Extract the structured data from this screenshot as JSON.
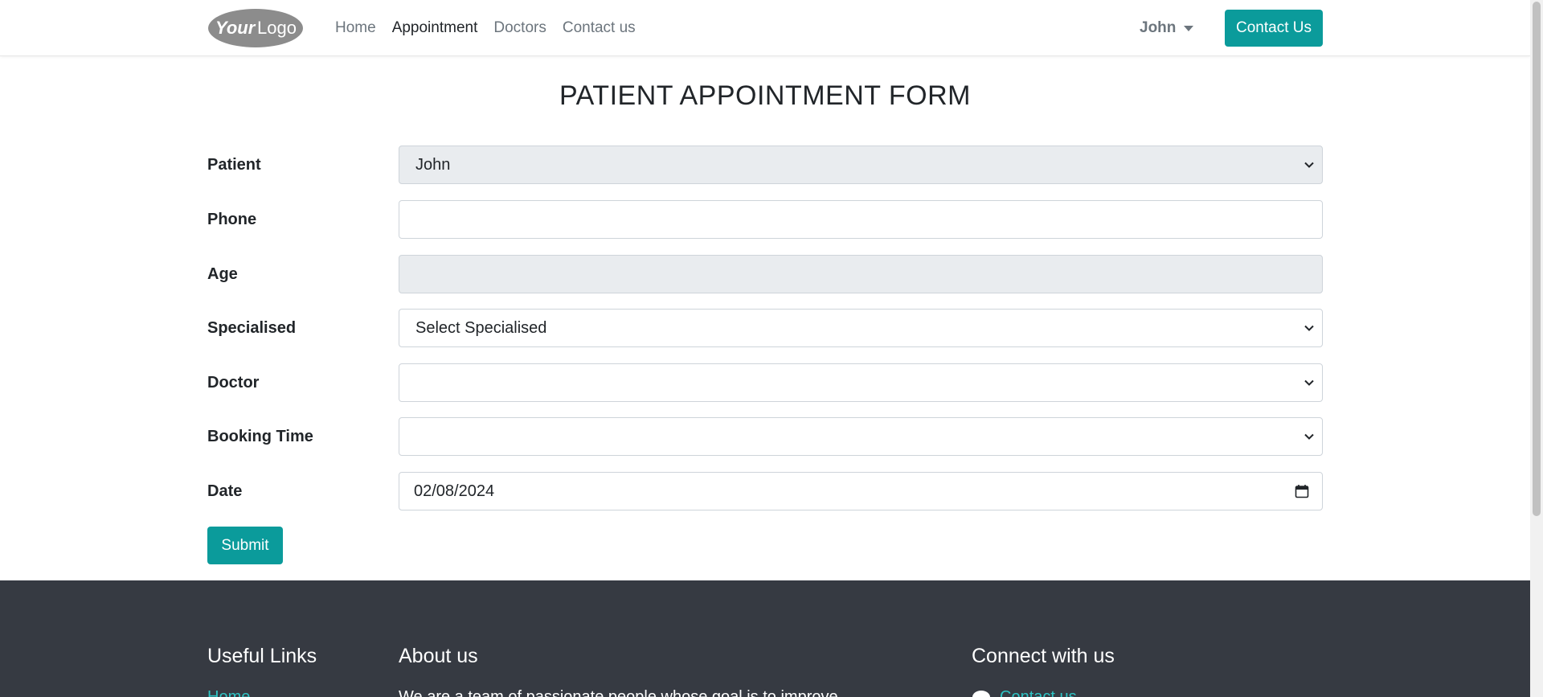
{
  "header": {
    "logo_text": "YourLogo",
    "nav": [
      {
        "label": "Home",
        "active": false
      },
      {
        "label": "Appointment",
        "active": true
      },
      {
        "label": "Doctors",
        "active": false
      },
      {
        "label": "Contact us",
        "active": false
      }
    ],
    "user_name": "John",
    "contact_button": "Contact Us"
  },
  "form": {
    "title": "PATIENT APPOINTMENT FORM",
    "fields": {
      "patient": {
        "label": "Patient",
        "value": "John"
      },
      "phone": {
        "label": "Phone",
        "value": ""
      },
      "age": {
        "label": "Age",
        "value": ""
      },
      "specialised": {
        "label": "Specialised",
        "value": "Select Specialised"
      },
      "doctor": {
        "label": "Doctor",
        "value": ""
      },
      "booking_time": {
        "label": "Booking Time",
        "value": ""
      },
      "date": {
        "label": "Date",
        "value": "02/08/2024"
      }
    },
    "submit_label": "Submit"
  },
  "footer": {
    "useful_links": {
      "heading": "Useful Links",
      "first_link": "Home"
    },
    "about": {
      "heading": "About us",
      "text": "We are a team of passionate people whose goal is to improve"
    },
    "connect": {
      "heading": "Connect with us",
      "first_link": "Contact us"
    }
  },
  "colors": {
    "accent": "#0b9b9b",
    "footer_bg": "#363a42",
    "footer_link": "#2ec4c4",
    "disabled_bg": "#e9ecef"
  }
}
